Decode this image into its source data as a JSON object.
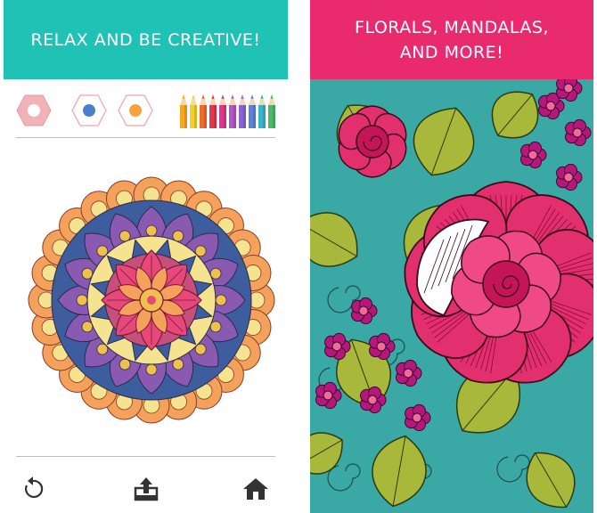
{
  "left_panel": {
    "banner_text": "RELAX AND BE CREATIVE!",
    "banner_color": "#1fc2b4",
    "tools": [
      {
        "name": "hexagon-palette-button",
        "fill": "#f2b3b8",
        "dot": "#ffffff"
      },
      {
        "name": "hexagon-blue-button",
        "fill": "#ffffff",
        "dot": "#4a7fd0"
      },
      {
        "name": "hexagon-orange-button",
        "fill": "#ffffff",
        "dot": "#f7a23a"
      }
    ],
    "pencil_colors": [
      "#f6a623",
      "#f5d02a",
      "#ef6c2f",
      "#e8344a",
      "#d83a8c",
      "#b455c8",
      "#8a63d2",
      "#5c80dc",
      "#3cb4c8",
      "#4cb96a"
    ],
    "mandala_colors": [
      "#e6487a",
      "#f4a25b",
      "#f6e38f",
      "#8a5ab3",
      "#3e5d9e",
      "#c74f7b",
      "#f0c04d"
    ],
    "bottom_icons": [
      "undo-icon",
      "share-icon",
      "home-icon"
    ]
  },
  "right_panel": {
    "banner_text": "FLORALS, MANDALAS, AND MORE!",
    "banner_color": "#ea2a6e",
    "floral_colors": [
      "#3aa8a4",
      "#a8b83a",
      "#e22f6e",
      "#b5177d",
      "#ffffff"
    ]
  }
}
